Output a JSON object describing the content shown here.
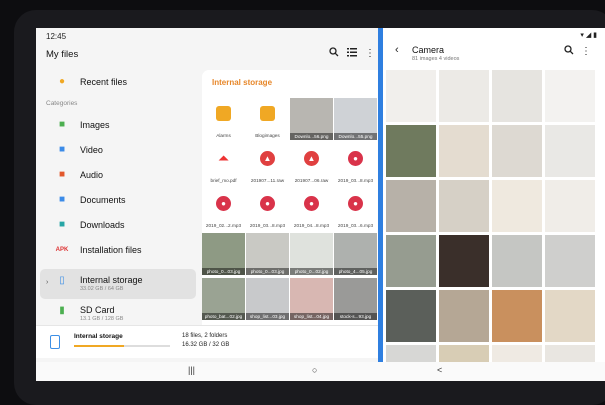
{
  "status": {
    "time": "12:45"
  },
  "myfiles": {
    "title": "My files",
    "recent": "Recent files",
    "categories_label": "Categories",
    "nav": [
      {
        "label": "Images",
        "icon": "image-icon",
        "color": "#4caf50"
      },
      {
        "label": "Video",
        "icon": "video-icon",
        "color": "#3b8be8"
      },
      {
        "label": "Audio",
        "icon": "audio-icon",
        "color": "#e2582c"
      },
      {
        "label": "Documents",
        "icon": "document-icon",
        "color": "#3b8be8"
      },
      {
        "label": "Downloads",
        "icon": "download-icon",
        "color": "#27a6a6"
      },
      {
        "label": "Installation files",
        "icon": "apk-icon",
        "color": "#d33"
      }
    ],
    "storages": [
      {
        "label": "Internal storage",
        "sub": "33.02 GB / 64 GB"
      },
      {
        "label": "SD Card",
        "sub": "13.1 GB / 128 GB"
      }
    ],
    "panel_title": "Internal storage",
    "files": [
      {
        "name": "Alarms",
        "kind": "folder"
      },
      {
        "name": "Blogimages",
        "kind": "folder"
      },
      {
        "name": "Downlo...56.png",
        "kind": "img",
        "bg": "#b8b6b1"
      },
      {
        "name": "Downlo...55.png",
        "kind": "img",
        "bg": "#cfd2d6"
      },
      {
        "name": "brief_mo.pdf",
        "kind": "pdf"
      },
      {
        "name": "201907...11.raw",
        "kind": "raw"
      },
      {
        "name": "201907...06.raw",
        "kind": "raw"
      },
      {
        "name": "2019_03...8.mp3",
        "kind": "mp3"
      },
      {
        "name": "2019_02...2.mp3",
        "kind": "mp3"
      },
      {
        "name": "2019_03...8.mp3",
        "kind": "mp3"
      },
      {
        "name": "2019_04...8.mp3",
        "kind": "mp3"
      },
      {
        "name": "2019_03...6.mp3",
        "kind": "mp3"
      },
      {
        "name": "photo_0...03.jpg",
        "kind": "img",
        "bg": "#8e9a84"
      },
      {
        "name": "photo_0...03.jpg",
        "kind": "img",
        "bg": "#c9c9c4"
      },
      {
        "name": "photo_0...02.jpg",
        "kind": "img",
        "bg": "#dfe2dd"
      },
      {
        "name": "photo_4...05.jpg",
        "kind": "img",
        "bg": "#aeb1ae"
      },
      {
        "name": "photo_bat...02.jpg",
        "kind": "img",
        "bg": "#9aa393"
      },
      {
        "name": "shop_list...03.jpg",
        "kind": "img",
        "bg": "#c8c9cb"
      },
      {
        "name": "shop_list...04.jpg",
        "kind": "img",
        "bg": "#d8b7b2"
      },
      {
        "name": "stock-s...93.jpg",
        "kind": "img",
        "bg": "#9a9a98"
      }
    ],
    "footer": {
      "name": "Internal storage",
      "progress_fraction": 0.52,
      "info1": "18 files, 2 folders",
      "info2": "16.32 GB / 32 GB"
    }
  },
  "camera": {
    "title": "Camera",
    "subtitle": "81 images 4 videos",
    "photos": [
      "#f1efec",
      "#eceae6",
      "#e6e4e0",
      "#f3f2f0",
      "#6f7a5e",
      "#e4dcd0",
      "#ddd9d2",
      "#e9e8e5",
      "#b7b1a8",
      "#d6d0c6",
      "#efe9df",
      "#f0ede8",
      "#969c90",
      "#3a2f2a",
      "#c5c6c3",
      "#cfcfcd",
      "#5b5f5a",
      "#b5a795",
      "#c9905e",
      "#e3d8c6",
      "#d7d7d5",
      "#d8cdb5",
      "#efeae3",
      "#e9e6e1"
    ]
  },
  "navbar": {
    "recents": "|||",
    "home": "○",
    "back": "<"
  }
}
